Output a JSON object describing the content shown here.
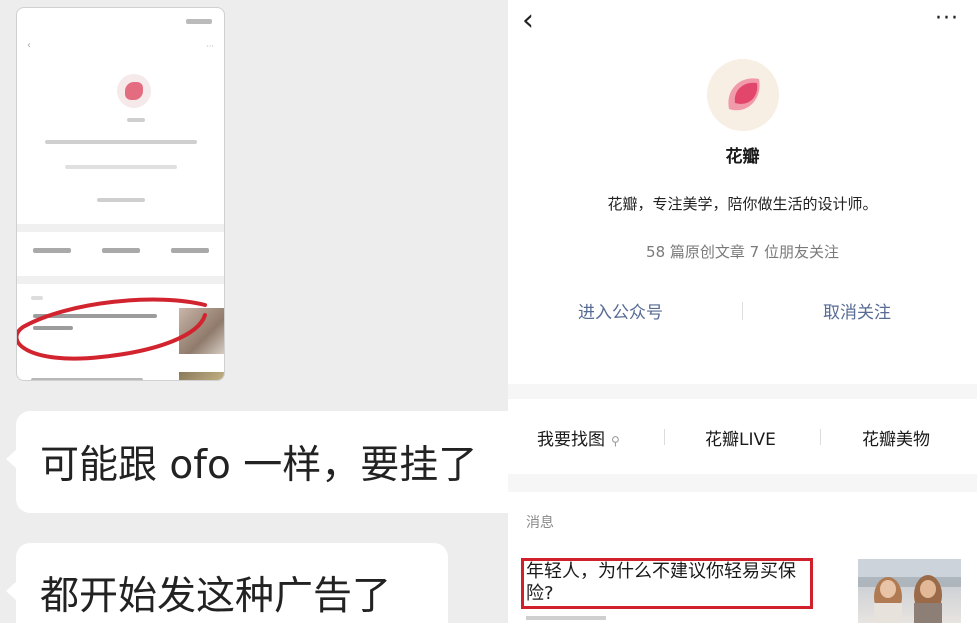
{
  "chat": {
    "messages": [
      {
        "text": "可能跟 ofo 一样，要挂了"
      },
      {
        "text": "都开始发这种广告了"
      }
    ]
  },
  "profile": {
    "name": "花瓣",
    "description": "花瓣，专注美学，陪你做生活的设计师。",
    "stats": "58 篇原创文章  7 位朋友关注",
    "actions": {
      "enter": "进入公众号",
      "unfollow": "取消关注"
    },
    "back_icon": "chevron-left-icon",
    "more_icon": "more-dots-icon"
  },
  "menu": {
    "items": [
      {
        "label": "我要找图",
        "icon": "link-icon"
      },
      {
        "label": "花瓣LIVE"
      },
      {
        "label": "花瓣美物"
      }
    ]
  },
  "news": {
    "section_label": "消息",
    "article_title": "年轻人，为什么不建议你轻易买保险?",
    "highlight_color": "#d21f2c"
  },
  "colors": {
    "link_blue": "#576b95",
    "brand_pink": "#e0566f",
    "chat_bg": "#ededed"
  }
}
